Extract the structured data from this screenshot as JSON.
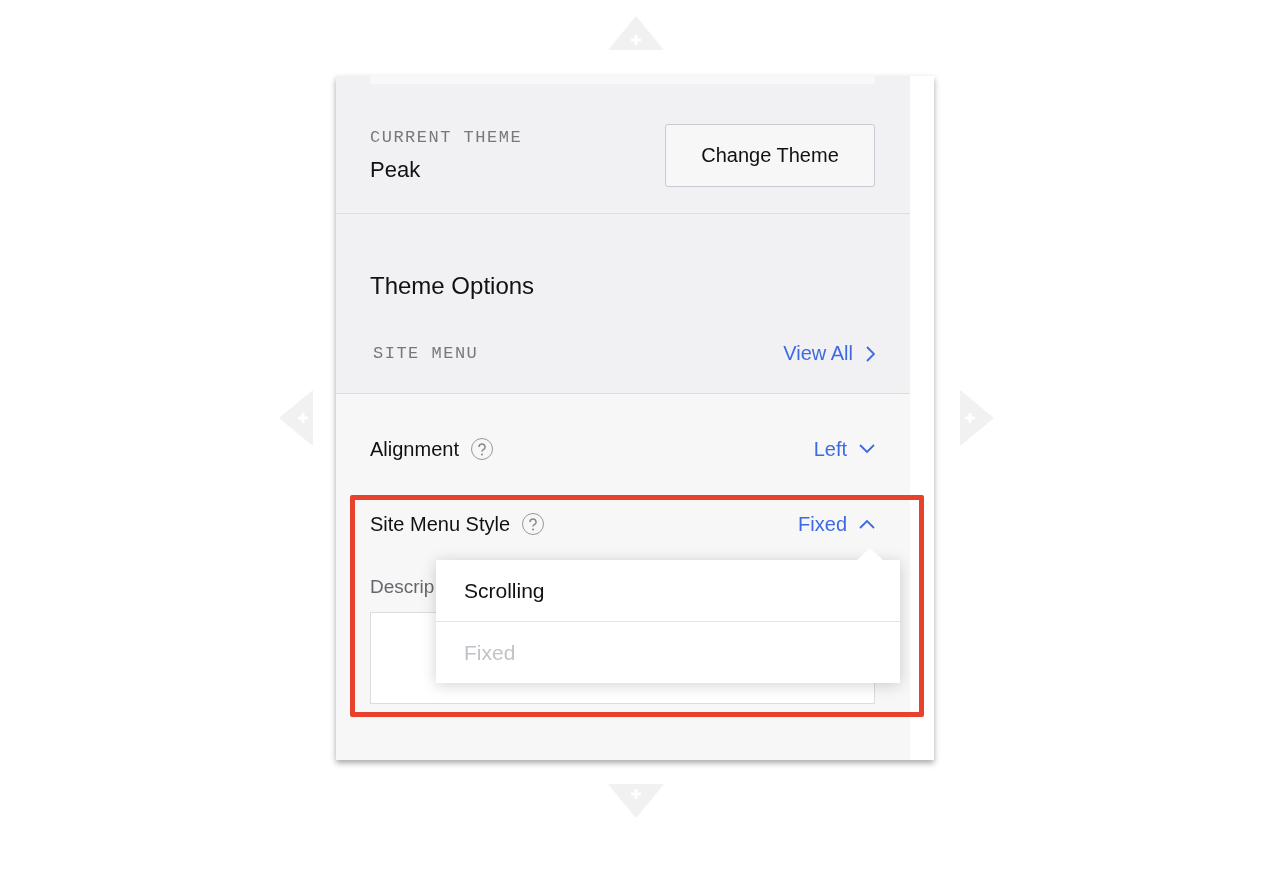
{
  "current_theme": {
    "label": "CURRENT THEME",
    "value": "Peak",
    "button": "Change Theme"
  },
  "theme_options": {
    "title": "Theme Options",
    "section_label": "SITE MENU",
    "link": "View All"
  },
  "settings": [
    {
      "label": "Alignment",
      "value": "Left",
      "expanded": false
    },
    {
      "label": "Site Menu Style",
      "value": "Fixed",
      "expanded": true
    }
  ],
  "description": {
    "label": "Descrip"
  },
  "dropdown": [
    {
      "label": "Scrolling",
      "selected": false
    },
    {
      "label": "Fixed",
      "selected": true
    }
  ],
  "highlight": true
}
